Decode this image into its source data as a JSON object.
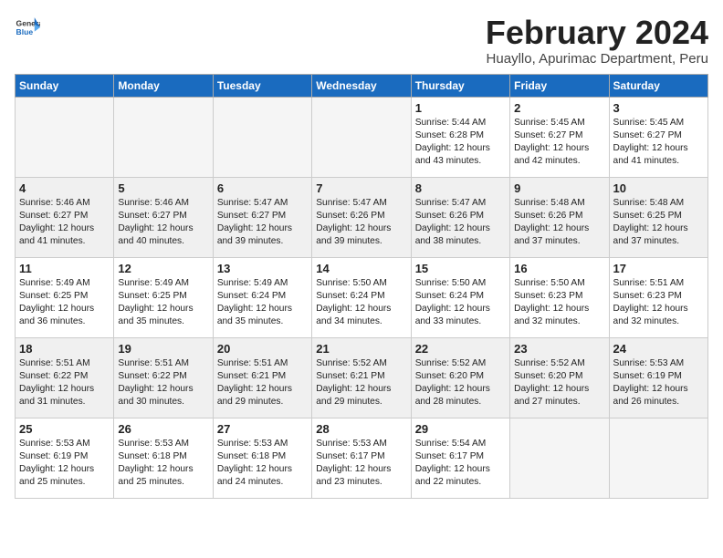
{
  "header": {
    "logo_general": "General",
    "logo_blue": "Blue",
    "title": "February 2024",
    "subtitle": "Huayllo, Apurimac Department, Peru"
  },
  "days_of_week": [
    "Sunday",
    "Monday",
    "Tuesday",
    "Wednesday",
    "Thursday",
    "Friday",
    "Saturday"
  ],
  "weeks": [
    [
      {
        "day": "",
        "info": "",
        "empty": true
      },
      {
        "day": "",
        "info": "",
        "empty": true
      },
      {
        "day": "",
        "info": "",
        "empty": true
      },
      {
        "day": "",
        "info": "",
        "empty": true
      },
      {
        "day": "1",
        "info": "Sunrise: 5:44 AM\nSunset: 6:28 PM\nDaylight: 12 hours\nand 43 minutes.",
        "empty": false
      },
      {
        "day": "2",
        "info": "Sunrise: 5:45 AM\nSunset: 6:27 PM\nDaylight: 12 hours\nand 42 minutes.",
        "empty": false
      },
      {
        "day": "3",
        "info": "Sunrise: 5:45 AM\nSunset: 6:27 PM\nDaylight: 12 hours\nand 41 minutes.",
        "empty": false
      }
    ],
    [
      {
        "day": "4",
        "info": "Sunrise: 5:46 AM\nSunset: 6:27 PM\nDaylight: 12 hours\nand 41 minutes.",
        "empty": false
      },
      {
        "day": "5",
        "info": "Sunrise: 5:46 AM\nSunset: 6:27 PM\nDaylight: 12 hours\nand 40 minutes.",
        "empty": false
      },
      {
        "day": "6",
        "info": "Sunrise: 5:47 AM\nSunset: 6:27 PM\nDaylight: 12 hours\nand 39 minutes.",
        "empty": false
      },
      {
        "day": "7",
        "info": "Sunrise: 5:47 AM\nSunset: 6:26 PM\nDaylight: 12 hours\nand 39 minutes.",
        "empty": false
      },
      {
        "day": "8",
        "info": "Sunrise: 5:47 AM\nSunset: 6:26 PM\nDaylight: 12 hours\nand 38 minutes.",
        "empty": false
      },
      {
        "day": "9",
        "info": "Sunrise: 5:48 AM\nSunset: 6:26 PM\nDaylight: 12 hours\nand 37 minutes.",
        "empty": false
      },
      {
        "day": "10",
        "info": "Sunrise: 5:48 AM\nSunset: 6:25 PM\nDaylight: 12 hours\nand 37 minutes.",
        "empty": false
      }
    ],
    [
      {
        "day": "11",
        "info": "Sunrise: 5:49 AM\nSunset: 6:25 PM\nDaylight: 12 hours\nand 36 minutes.",
        "empty": false
      },
      {
        "day": "12",
        "info": "Sunrise: 5:49 AM\nSunset: 6:25 PM\nDaylight: 12 hours\nand 35 minutes.",
        "empty": false
      },
      {
        "day": "13",
        "info": "Sunrise: 5:49 AM\nSunset: 6:24 PM\nDaylight: 12 hours\nand 35 minutes.",
        "empty": false
      },
      {
        "day": "14",
        "info": "Sunrise: 5:50 AM\nSunset: 6:24 PM\nDaylight: 12 hours\nand 34 minutes.",
        "empty": false
      },
      {
        "day": "15",
        "info": "Sunrise: 5:50 AM\nSunset: 6:24 PM\nDaylight: 12 hours\nand 33 minutes.",
        "empty": false
      },
      {
        "day": "16",
        "info": "Sunrise: 5:50 AM\nSunset: 6:23 PM\nDaylight: 12 hours\nand 32 minutes.",
        "empty": false
      },
      {
        "day": "17",
        "info": "Sunrise: 5:51 AM\nSunset: 6:23 PM\nDaylight: 12 hours\nand 32 minutes.",
        "empty": false
      }
    ],
    [
      {
        "day": "18",
        "info": "Sunrise: 5:51 AM\nSunset: 6:22 PM\nDaylight: 12 hours\nand 31 minutes.",
        "empty": false
      },
      {
        "day": "19",
        "info": "Sunrise: 5:51 AM\nSunset: 6:22 PM\nDaylight: 12 hours\nand 30 minutes.",
        "empty": false
      },
      {
        "day": "20",
        "info": "Sunrise: 5:51 AM\nSunset: 6:21 PM\nDaylight: 12 hours\nand 29 minutes.",
        "empty": false
      },
      {
        "day": "21",
        "info": "Sunrise: 5:52 AM\nSunset: 6:21 PM\nDaylight: 12 hours\nand 29 minutes.",
        "empty": false
      },
      {
        "day": "22",
        "info": "Sunrise: 5:52 AM\nSunset: 6:20 PM\nDaylight: 12 hours\nand 28 minutes.",
        "empty": false
      },
      {
        "day": "23",
        "info": "Sunrise: 5:52 AM\nSunset: 6:20 PM\nDaylight: 12 hours\nand 27 minutes.",
        "empty": false
      },
      {
        "day": "24",
        "info": "Sunrise: 5:53 AM\nSunset: 6:19 PM\nDaylight: 12 hours\nand 26 minutes.",
        "empty": false
      }
    ],
    [
      {
        "day": "25",
        "info": "Sunrise: 5:53 AM\nSunset: 6:19 PM\nDaylight: 12 hours\nand 25 minutes.",
        "empty": false
      },
      {
        "day": "26",
        "info": "Sunrise: 5:53 AM\nSunset: 6:18 PM\nDaylight: 12 hours\nand 25 minutes.",
        "empty": false
      },
      {
        "day": "27",
        "info": "Sunrise: 5:53 AM\nSunset: 6:18 PM\nDaylight: 12 hours\nand 24 minutes.",
        "empty": false
      },
      {
        "day": "28",
        "info": "Sunrise: 5:53 AM\nSunset: 6:17 PM\nDaylight: 12 hours\nand 23 minutes.",
        "empty": false
      },
      {
        "day": "29",
        "info": "Sunrise: 5:54 AM\nSunset: 6:17 PM\nDaylight: 12 hours\nand 22 minutes.",
        "empty": false
      },
      {
        "day": "",
        "info": "",
        "empty": true
      },
      {
        "day": "",
        "info": "",
        "empty": true
      }
    ]
  ]
}
